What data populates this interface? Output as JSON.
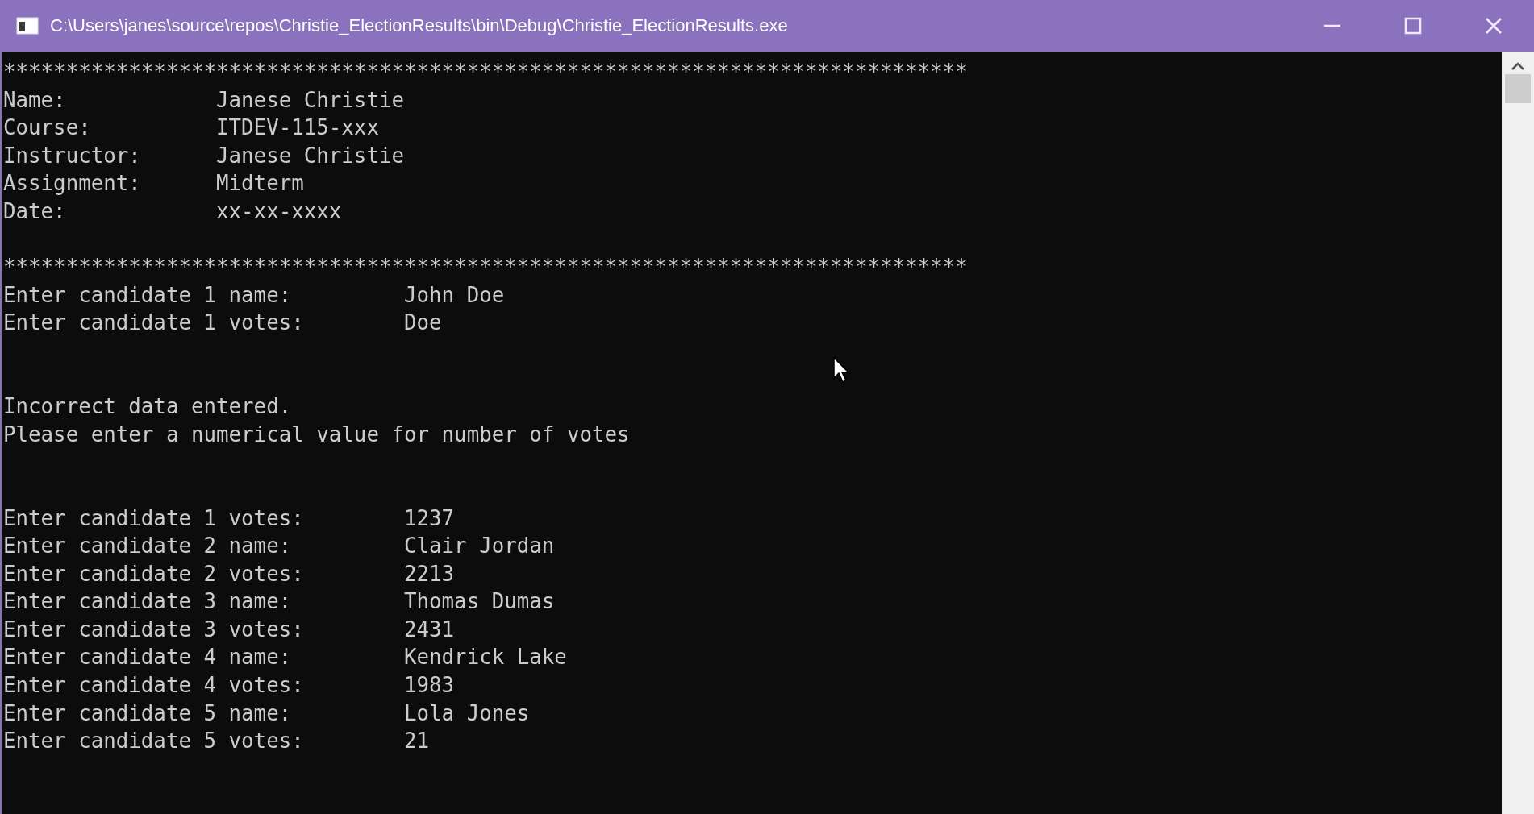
{
  "window": {
    "title": "C:\\Users\\janes\\source\\repos\\Christie_ElectionResults\\bin\\Debug\\Christie_ElectionResults.exe"
  },
  "console": {
    "lines": [
      {
        "kind": "rule",
        "text": "*****************************************************************************"
      },
      {
        "kind": "field",
        "label": "Name:",
        "value": "Janese Christie"
      },
      {
        "kind": "field",
        "label": "Course:",
        "value": "ITDEV-115-xxx"
      },
      {
        "kind": "field",
        "label": "Instructor:",
        "value": "Janese Christie"
      },
      {
        "kind": "field",
        "label": "Assignment:",
        "value": "Midterm"
      },
      {
        "kind": "field",
        "label": "Date:",
        "value": "xx-xx-xxxx"
      },
      {
        "kind": "blank"
      },
      {
        "kind": "rule",
        "text": "*****************************************************************************"
      },
      {
        "kind": "prompt",
        "label": "Enter candidate 1 name:",
        "value": "John Doe"
      },
      {
        "kind": "prompt",
        "label": "Enter candidate 1 votes:",
        "value": "Doe"
      },
      {
        "kind": "blank"
      },
      {
        "kind": "blank"
      },
      {
        "kind": "text",
        "text": "Incorrect data entered."
      },
      {
        "kind": "text",
        "text": "Please enter a numerical value for number of votes"
      },
      {
        "kind": "blank"
      },
      {
        "kind": "blank"
      },
      {
        "kind": "prompt",
        "label": "Enter candidate 1 votes:",
        "value": "1237"
      },
      {
        "kind": "prompt",
        "label": "Enter candidate 2 name:",
        "value": "Clair Jordan"
      },
      {
        "kind": "prompt",
        "label": "Enter candidate 2 votes:",
        "value": "2213"
      },
      {
        "kind": "prompt",
        "label": "Enter candidate 3 name:",
        "value": "Thomas Dumas"
      },
      {
        "kind": "prompt",
        "label": "Enter candidate 3 votes:",
        "value": "2431"
      },
      {
        "kind": "prompt",
        "label": "Enter candidate 4 name:",
        "value": "Kendrick Lake"
      },
      {
        "kind": "prompt",
        "label": "Enter candidate 4 votes:",
        "value": "1983"
      },
      {
        "kind": "prompt",
        "label": "Enter candidate 5 name:",
        "value": "Lola Jones"
      },
      {
        "kind": "prompt",
        "label": "Enter candidate 5 votes:",
        "value": "21"
      }
    ]
  }
}
